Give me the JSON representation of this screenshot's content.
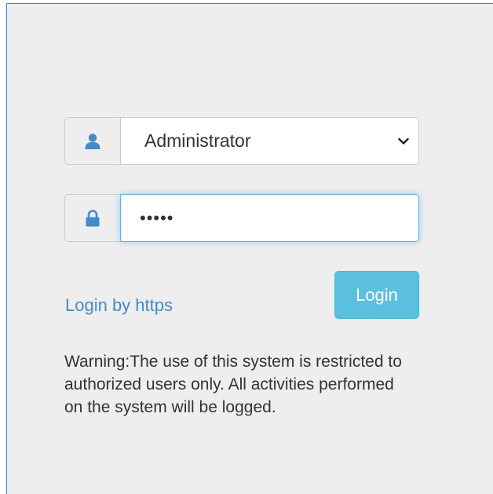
{
  "login_form": {
    "user_select": {
      "selected_value": "Administrator",
      "icon": "user-icon"
    },
    "password": {
      "value": "•••••",
      "icon": "lock-icon"
    },
    "login_button_label": "Login",
    "https_link_label": "Login by https",
    "warning_text": "Warning:The use of this system is restricted to authorized users only. All activities performed on the system will be logged."
  },
  "colors": {
    "panel_bg": "#eeeeee",
    "icon_blue": "#428bca",
    "button_bg": "#5bc0de",
    "link": "#428bca",
    "focus_border": "#66afe9"
  }
}
